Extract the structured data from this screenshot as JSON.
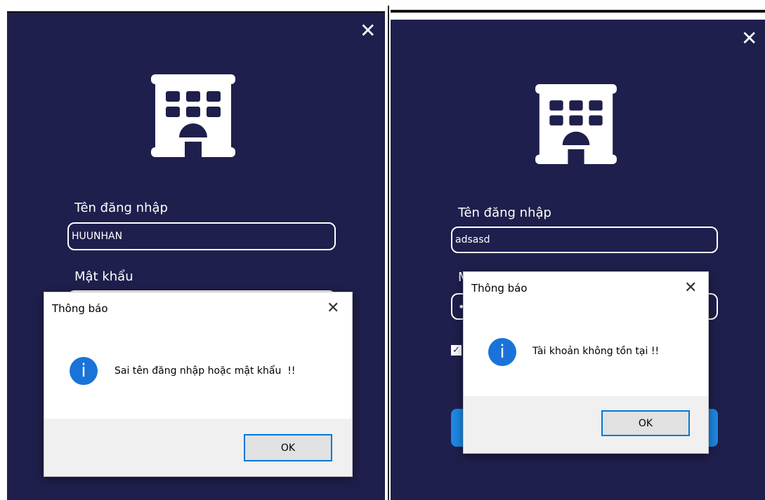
{
  "left_window": {
    "close_symbol": "✕",
    "username_label": "Tên đăng nhập",
    "username_value": "HUUNHAN",
    "password_label": "Mật khẩu",
    "dialog": {
      "title": "Thông báo",
      "close_symbol": "✕",
      "icon_glyph": "i",
      "message": "Sai tên đăng nhập hoặc mật khẩu  !!",
      "ok_label": "OK"
    }
  },
  "right_window": {
    "close_symbol": "✕",
    "username_label": "Tên đăng nhập",
    "username_value": "adsasd",
    "password_label_partial": "M",
    "password_dot": "•",
    "checkbox_mark": "✓",
    "dialog": {
      "title": "Thông báo",
      "close_symbol": "✕",
      "icon_glyph": "i",
      "message": "Tài khoản không tồn tại !!",
      "ok_label": "OK"
    }
  },
  "colors": {
    "panel_bg": "#1f1f4d",
    "accent_blue": "#1e88e5",
    "info_icon": "#1a73d9",
    "ok_border": "#0078d7"
  },
  "icons": {
    "building": "building-icon",
    "info": "info-icon",
    "close": "close-icon"
  }
}
